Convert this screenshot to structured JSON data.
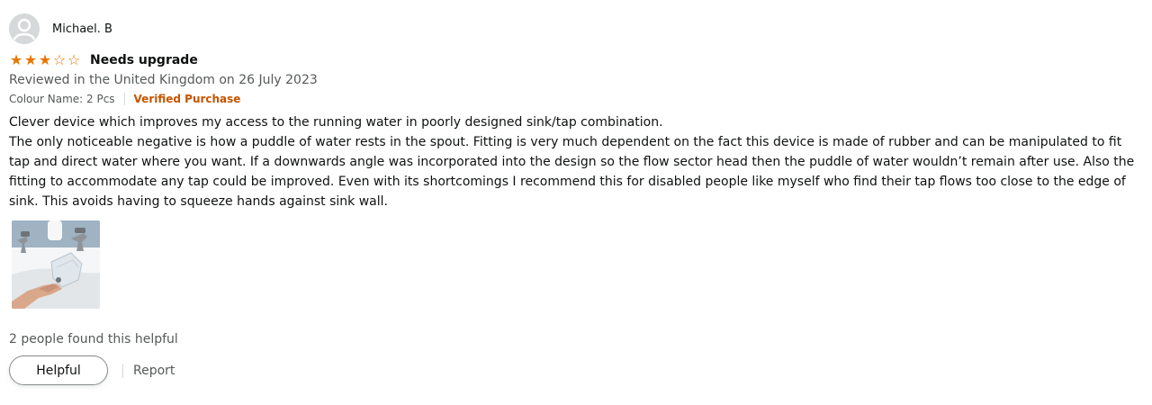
{
  "profile": {
    "name": "Michael. B",
    "avatar_icon": "person-silhouette-icon"
  },
  "review": {
    "rating": 3,
    "max_rating": 5,
    "star_color": "#e77600",
    "title": "Needs upgrade",
    "date": "Reviewed in the United Kingdom on 26 July 2023",
    "variant": "Colour Name: 2 Pcs",
    "verified_label": "Verified Purchase",
    "verified_color": "#c45500",
    "body": "Clever device which improves my access to the running water in poorly designed sink/tap combination.\nThe only noticeable negative is how a puddle of water rests in the spout. Fitting is very much dependent on the fact this device is made of rubber and can be manipulated to fit tap and direct water where you want. If a downwards angle was incorporated into the design so the flow sector head then the puddle of water wouldn’t remain after use. Also the fitting to accommodate any tap could be improved. Even with its shortcomings I recommend this for disabled people like myself who find their tap flows too close to the edge of sink. This avoids having to squeeze hands against sink wall.",
    "image_icon": "customer-photo-sink-tap-icon"
  },
  "helpful": {
    "count_text": "2 people found this helpful",
    "button_label": "Helpful",
    "report_label": "Report"
  }
}
